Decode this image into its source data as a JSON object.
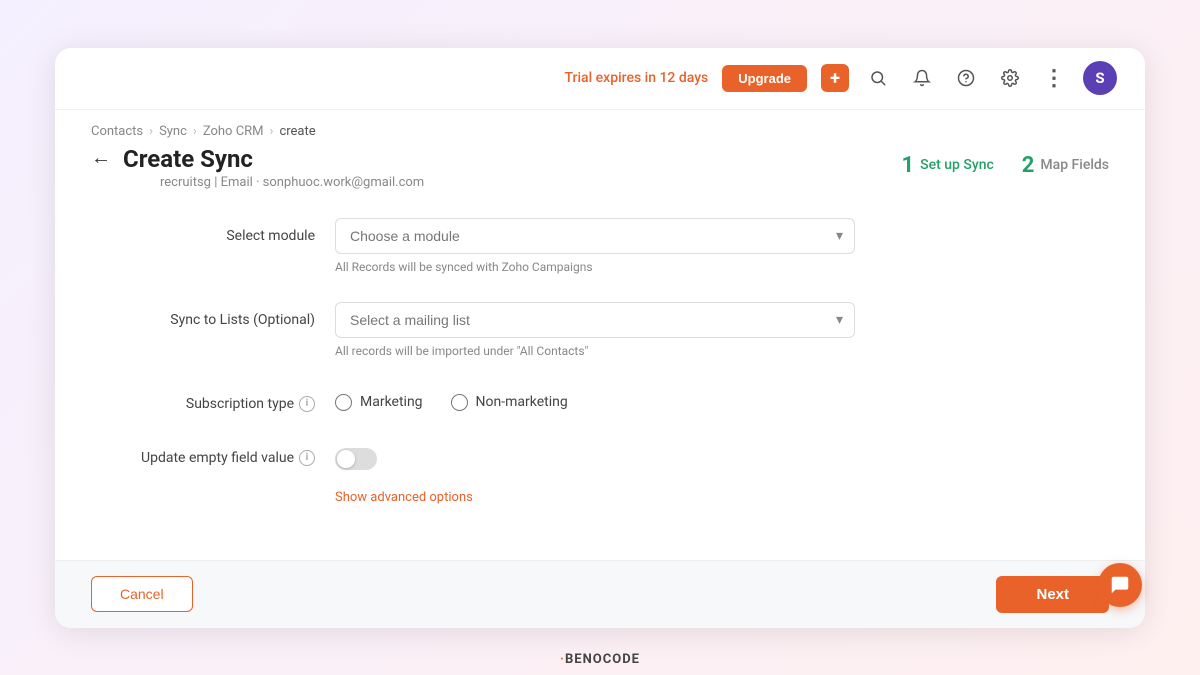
{
  "topbar": {
    "trial_text": "Trial expires in 12 days",
    "upgrade_label": "Upgrade",
    "plus_icon": "+",
    "search_icon": "🔍",
    "bell_icon": "🔔",
    "help_icon": "?",
    "settings_icon": "⚙",
    "more_icon": "⋮",
    "avatar_letter": "S"
  },
  "breadcrumb": {
    "contacts": "Contacts",
    "sync": "Sync",
    "zoho_crm": "Zoho CRM",
    "create": "create"
  },
  "page": {
    "back_icon": "←",
    "title": "Create Sync",
    "subtitle": "recruitsg | Email · sonphuoc.work@gmail.com"
  },
  "steps": [
    {
      "num": "1",
      "label": "Set up Sync",
      "state": "active"
    },
    {
      "num": "2",
      "label": "Map Fields",
      "state": "done"
    }
  ],
  "form": {
    "select_module_label": "Select module",
    "select_module_placeholder": "Choose a module",
    "select_module_hint": "All Records will be synced with Zoho Campaigns",
    "sync_lists_label": "Sync to Lists (Optional)",
    "sync_lists_placeholder": "Select a mailing list",
    "sync_lists_hint": "All records will be imported under \"All Contacts\"",
    "subscription_label": "Subscription type",
    "subscription_info_title": "Subscription type info",
    "marketing_label": "Marketing",
    "nonmarketing_label": "Non-marketing",
    "update_empty_label": "Update empty field value",
    "update_empty_info_title": "Update empty field value info",
    "show_advanced": "Show advanced options"
  },
  "footer": {
    "cancel_label": "Cancel",
    "next_label": "Next"
  },
  "brand": {
    "dot": "·",
    "name": "BENOCODE"
  }
}
